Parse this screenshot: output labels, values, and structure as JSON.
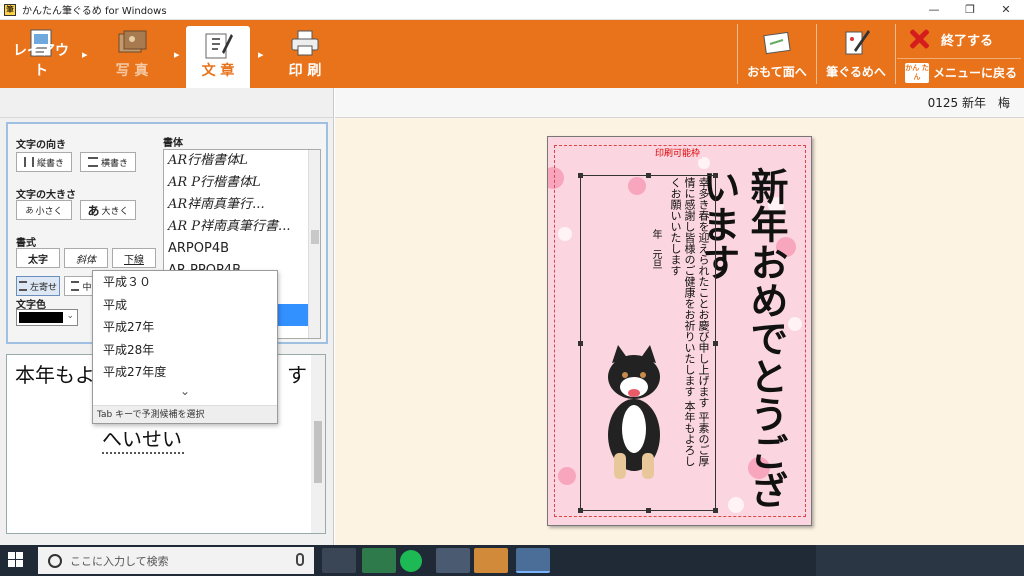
{
  "window": {
    "title": "かんたん筆ぐるめ for Windows"
  },
  "toolbar": {
    "steps": [
      {
        "label": "レイアウト",
        "icon": "layout-icon",
        "active": false
      },
      {
        "label": "写 真",
        "icon": "photo-icon",
        "active": false
      },
      {
        "label": "文 章",
        "icon": "text-icon",
        "active": true
      },
      {
        "label": "印 刷",
        "icon": "printer-icon",
        "active": false
      }
    ],
    "front_label": "おもて面へ",
    "fudegurume_label": "筆ぐるめへ",
    "exit_label": "終了する",
    "menu_badge": "かん たん",
    "menu_label": "メニューに戻る"
  },
  "left_panel": {
    "direction_label": "文字の向き",
    "vertical_button": "縦書き",
    "horizontal_button": "横書き",
    "size_label": "文字の大きさ",
    "smaller_button": "小さく",
    "larger_button": "大きく",
    "style_label": "書式",
    "bold_button": "太字",
    "italic_button": "斜体",
    "underline_button": "下線",
    "align_left_button": "左寄せ",
    "align_center_button": "中寄",
    "color_label": "文字色",
    "color_value": "#000000",
    "font_label": "書体",
    "fonts": [
      "AR行楷書体L",
      "AR P行楷書体L",
      "AR祥南真筆行...",
      "AR P祥南真筆行書...",
      "ARPOP4B",
      "AR PPOP4B"
    ]
  },
  "editor": {
    "line1_start": "本年もよ",
    "line1_end": "す",
    "ime_composition": "へいせい"
  },
  "ime_candidates": {
    "items": [
      "平成３０",
      "平成",
      "平成27年",
      "平成28年",
      "平成27年度"
    ],
    "more": "⌄",
    "footer": "Tab キーで予測候補を選択"
  },
  "preview": {
    "card_info": "0125 新年　梅",
    "print_frame_label": "印刷可能枠",
    "big_message": "新年おめでとうございます",
    "body_text": "幸多き春を迎えられたことお慶び申し上げます 平素のご厚情に感謝し皆様のご健康をお祈りいたします 本年もよろしくお願いいたします",
    "year_text": "年　元旦"
  },
  "taskbar": {
    "search_placeholder": "ここに入力して検索"
  }
}
